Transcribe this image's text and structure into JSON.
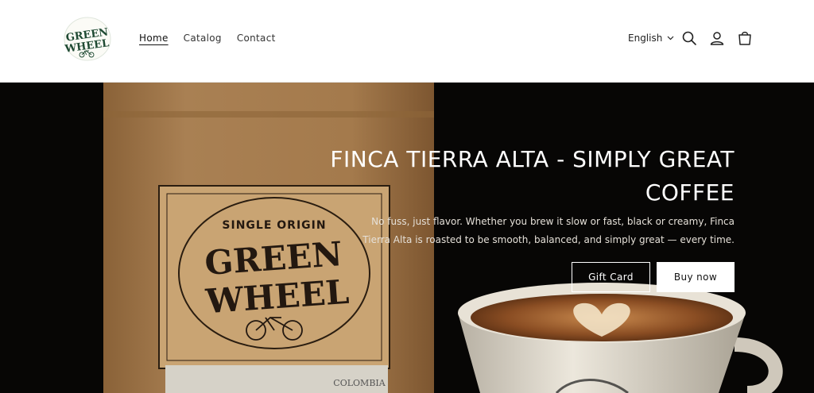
{
  "header": {
    "logo": {
      "line1": "GREEN",
      "line2": "WHEEL"
    },
    "nav": [
      {
        "label": "Home",
        "active": true
      },
      {
        "label": "Catalog",
        "active": false
      },
      {
        "label": "Contact",
        "active": false
      }
    ],
    "language": "English",
    "icons": [
      "chevron-down-icon",
      "search-icon",
      "account-icon",
      "cart-icon"
    ]
  },
  "hero": {
    "title": "FINCA TIERRA ALTA - SIMPLY GREAT COFFEE",
    "subtitle": "No fuss, just flavor. Whether you brew it slow or fast, black or creamy, Finca Tierra Alta is roasted to be smooth, balanced, and simply great — every time.",
    "buttons": {
      "gift_card": "Gift Card",
      "buy_now": "Buy now"
    },
    "bag": {
      "label_top": "SINGLE ORIGIN",
      "brand_line1": "GREEN",
      "brand_line2": "WHEEL",
      "origin": "COLOMBIA"
    }
  },
  "colors": {
    "hero_bg": "#070605",
    "bag": "#a47a4c",
    "label": "#c9a473",
    "cup": "#e8e2d6",
    "coffee": "#8a4d23",
    "text_dark": "#222222"
  }
}
